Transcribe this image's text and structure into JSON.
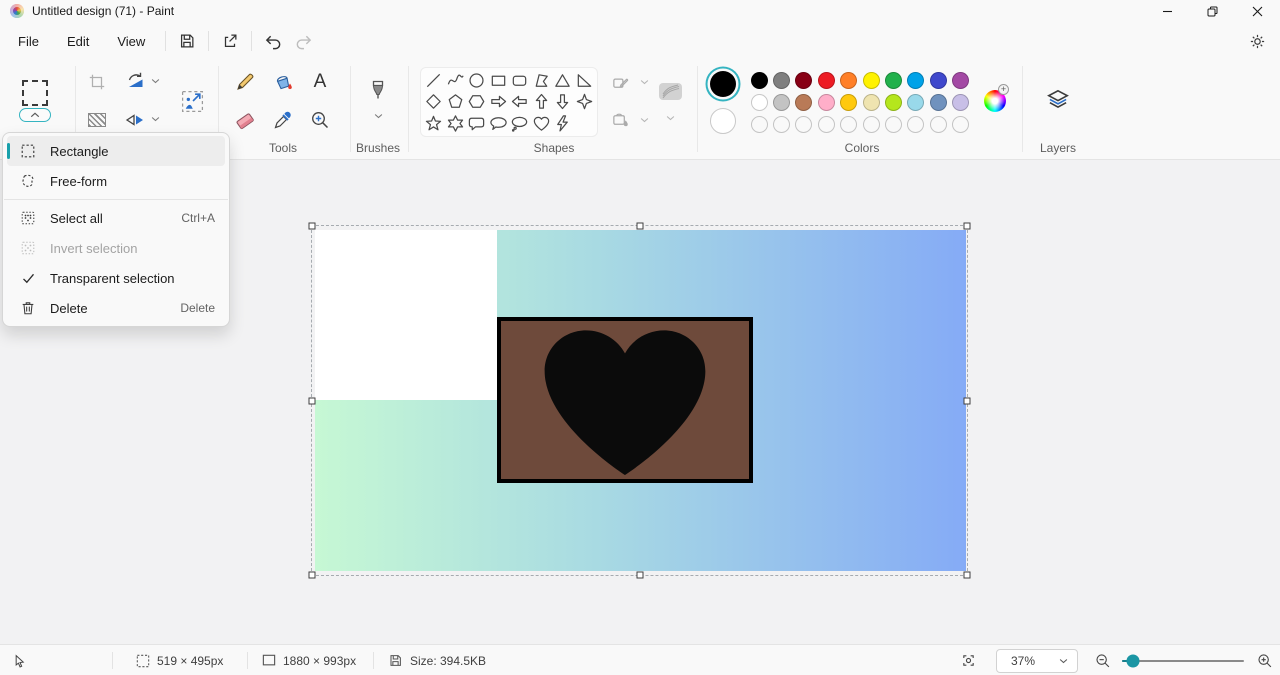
{
  "window": {
    "title": "Untitled design (71) - Paint"
  },
  "menubar": {
    "items": [
      "File",
      "Edit",
      "View"
    ]
  },
  "toolbar": {
    "labels": {
      "tools": "Tools",
      "brushes": "Brushes",
      "shapes": "Shapes",
      "colors": "Colors",
      "layers": "Layers"
    },
    "text_tool_glyph": "A"
  },
  "selection_menu": {
    "items": [
      {
        "label": "Rectangle",
        "icon": "rectangle-select-icon",
        "selected": true
      },
      {
        "label": "Free-form",
        "icon": "freeform-select-icon"
      },
      {
        "label": "Select all",
        "icon": "select-all-icon",
        "shortcut": "Ctrl+A"
      },
      {
        "label": "Invert selection",
        "icon": "invert-selection-icon",
        "disabled": true
      },
      {
        "label": "Transparent selection",
        "icon": "checkmark-icon",
        "checked": true
      },
      {
        "label": "Delete",
        "icon": "trash-icon",
        "shortcut": "Delete"
      }
    ]
  },
  "shapes": {
    "items": [
      "line",
      "curve",
      "ellipse",
      "rectangle",
      "rounded-rectangle",
      "polygon",
      "triangle",
      "right-triangle",
      "diamond",
      "pentagon",
      "hexagon",
      "arrow-right",
      "arrow-left",
      "arrow-up",
      "arrow-down",
      "star-four",
      "star-five",
      "star-six",
      "speech-bubble",
      "speech-bubble-oval",
      "thought-bubble",
      "heart",
      "lightning"
    ]
  },
  "colors": {
    "accent": "#18a0ab",
    "foreground": "#000000",
    "background": "#ffffff",
    "rows": [
      [
        "#000000",
        "#7f7f7f",
        "#880015",
        "#ed1c24",
        "#ff7f27",
        "#fff200",
        "#22b14c",
        "#00a2e8",
        "#3f48cc",
        "#a349a4"
      ],
      [
        "#ffffff",
        "#c3c3c3",
        "#b97a57",
        "#ffaec9",
        "#ffc90e",
        "#efe4b0",
        "#b5e61d",
        "#99d9ea",
        "#7092be",
        "#c8bfe7"
      ]
    ],
    "custom_slots": 10
  },
  "canvas_image": {
    "gradient_left": "#c6f8d4",
    "gradient_mid": "#a9dbe2",
    "gradient_right": "#85abf6",
    "white_rect_color": "#ffffff",
    "brown_rect_fill": "#6e4a3b",
    "brown_rect_border": "#000000",
    "heart_color": "#0b0b0b"
  },
  "statusbar": {
    "selection_size": "519 × 495px",
    "canvas_size": "1880 × 993px",
    "file_size": "Size: 394.5KB",
    "zoom_value": "37%"
  }
}
